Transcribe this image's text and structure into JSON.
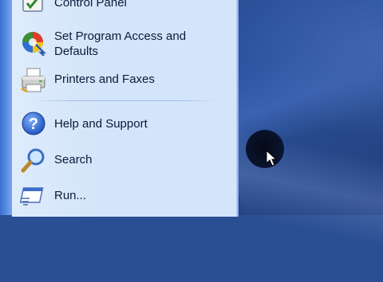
{
  "start_menu": {
    "items": [
      {
        "label": "Control Panel",
        "icon": "control-panel-icon"
      },
      {
        "label": "Set Program Access and Defaults",
        "icon": "program-access-icon"
      },
      {
        "label": "Printers and Faxes",
        "icon": "printer-icon"
      },
      {
        "label": "Help and Support",
        "icon": "help-icon"
      },
      {
        "label": "Search",
        "icon": "search-icon"
      },
      {
        "label": "Run...",
        "icon": "run-icon"
      }
    ]
  },
  "colors": {
    "menu_background": "#d3e5fa",
    "desktop_background": "#2b4f93",
    "text": "#0a1a3a"
  }
}
